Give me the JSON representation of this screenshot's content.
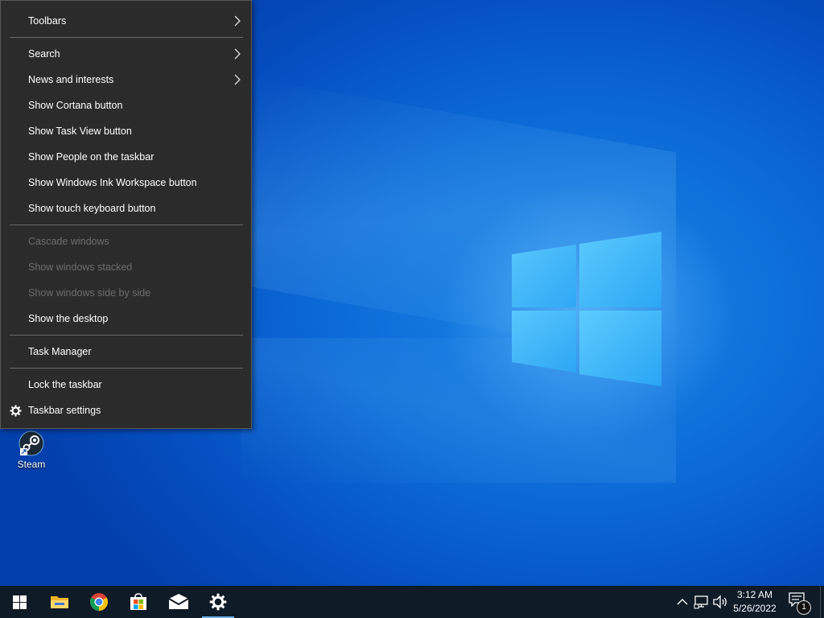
{
  "context_menu": {
    "items": [
      {
        "label": "Toolbars",
        "submenu": true,
        "enabled": true
      },
      {
        "label": "Search",
        "submenu": true,
        "enabled": true
      },
      {
        "label": "News and interests",
        "submenu": true,
        "enabled": true
      },
      {
        "label": "Show Cortana button",
        "submenu": false,
        "enabled": true
      },
      {
        "label": "Show Task View button",
        "submenu": false,
        "enabled": true
      },
      {
        "label": "Show People on the taskbar",
        "submenu": false,
        "enabled": true
      },
      {
        "label": "Show Windows Ink Workspace button",
        "submenu": false,
        "enabled": true
      },
      {
        "label": "Show touch keyboard button",
        "submenu": false,
        "enabled": true
      },
      {
        "label": "Cascade windows",
        "submenu": false,
        "enabled": false
      },
      {
        "label": "Show windows stacked",
        "submenu": false,
        "enabled": false
      },
      {
        "label": "Show windows side by side",
        "submenu": false,
        "enabled": false
      },
      {
        "label": "Show the desktop",
        "submenu": false,
        "enabled": true
      },
      {
        "label": "Task Manager",
        "submenu": false,
        "enabled": true
      },
      {
        "label": "Lock the taskbar",
        "submenu": false,
        "enabled": true
      },
      {
        "label": "Taskbar settings",
        "submenu": false,
        "enabled": true,
        "icon": "gear-icon"
      }
    ]
  },
  "desktop": {
    "icons": [
      {
        "label": "Steam",
        "icon": "steam-icon"
      }
    ]
  },
  "taskbar": {
    "apps": [
      {
        "name": "start",
        "icon": "windows-logo-icon"
      },
      {
        "name": "file-explorer",
        "icon": "folder-icon"
      },
      {
        "name": "chrome",
        "icon": "chrome-icon"
      },
      {
        "name": "microsoft-store",
        "icon": "store-icon"
      },
      {
        "name": "mail",
        "icon": "mail-icon"
      },
      {
        "name": "settings",
        "icon": "gear-icon",
        "active": true
      }
    ],
    "tray": {
      "icons": [
        "chevron-up-icon",
        "network-icon",
        "volume-icon"
      ],
      "time": "3:12 AM",
      "date": "5/26/2022",
      "notification_count": "1"
    }
  },
  "colors": {
    "menu_bg": "#2b2b2b",
    "taskbar_bg": "#0f1b26",
    "desktop_blue": "#0b6ad6",
    "disabled_text": "#6d6d6d"
  }
}
